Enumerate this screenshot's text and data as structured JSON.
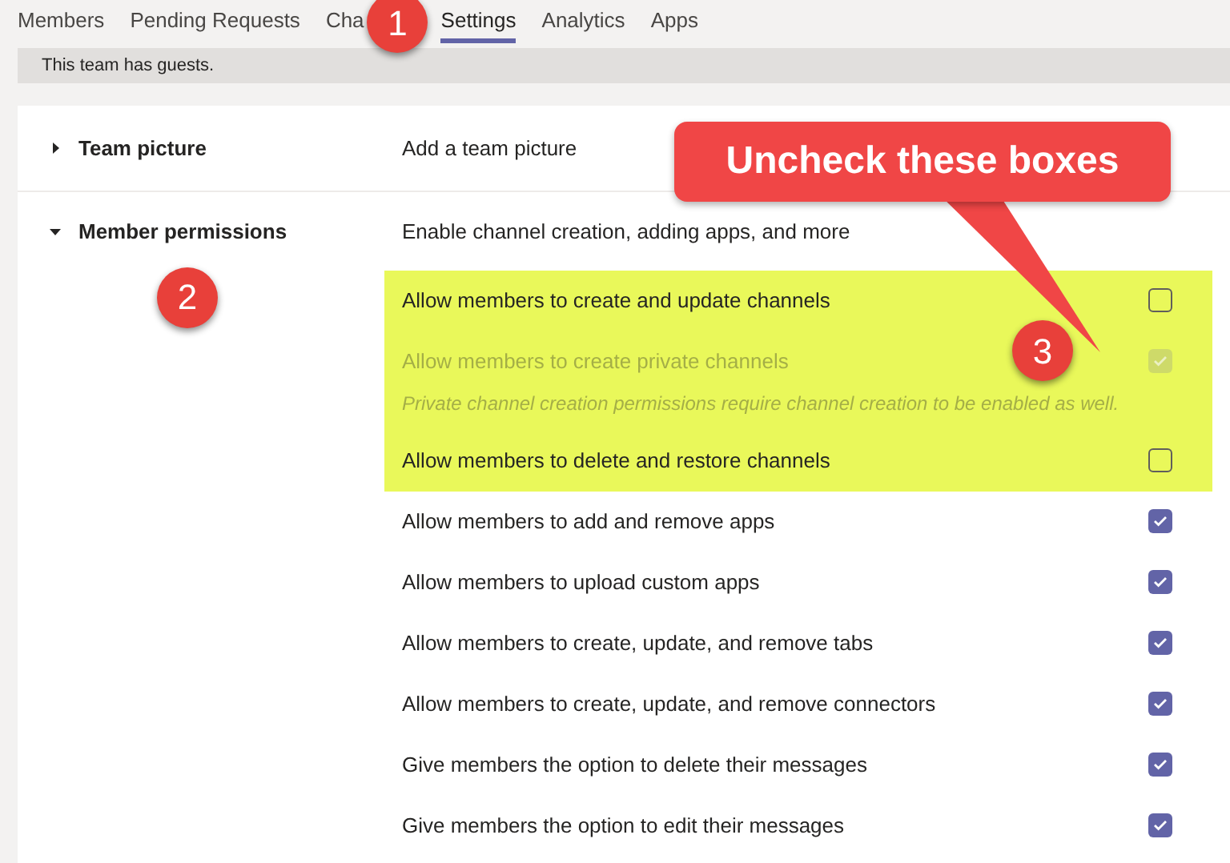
{
  "tabs": [
    {
      "label": "Members",
      "selected": false
    },
    {
      "label": "Pending Requests",
      "selected": false
    },
    {
      "label": "Cha",
      "selected": false
    },
    {
      "label": "Settings",
      "selected": true
    },
    {
      "label": "Analytics",
      "selected": false
    },
    {
      "label": "Apps",
      "selected": false
    }
  ],
  "banner": "This team has guests.",
  "sections": [
    {
      "title": "Team picture",
      "expanded": false,
      "description": "Add a team picture"
    },
    {
      "title": "Member permissions",
      "expanded": true,
      "description": "Enable channel creation, adding apps, and more",
      "settings": [
        {
          "kind": "toggle",
          "label": "Allow members to create and update channels",
          "checked": false,
          "disabled": false,
          "highlighted": true
        },
        {
          "kind": "toggle",
          "label": "Allow members to create private channels",
          "checked": true,
          "disabled": true,
          "highlighted": true
        },
        {
          "kind": "note",
          "label": "Private channel creation permissions require channel creation to be enabled as well.",
          "highlighted": true
        },
        {
          "kind": "toggle",
          "label": "Allow members to delete and restore channels",
          "checked": false,
          "disabled": false,
          "highlighted": true
        },
        {
          "kind": "toggle",
          "label": "Allow members to add and remove apps",
          "checked": true,
          "disabled": false,
          "highlighted": false
        },
        {
          "kind": "toggle",
          "label": "Allow members to upload custom apps",
          "checked": true,
          "disabled": false,
          "highlighted": false
        },
        {
          "kind": "toggle",
          "label": "Allow members to create, update, and remove tabs",
          "checked": true,
          "disabled": false,
          "highlighted": false
        },
        {
          "kind": "toggle",
          "label": "Allow members to create, update, and remove connectors",
          "checked": true,
          "disabled": false,
          "highlighted": false
        },
        {
          "kind": "toggle",
          "label": "Give members the option to delete their messages",
          "checked": true,
          "disabled": false,
          "highlighted": false
        },
        {
          "kind": "toggle",
          "label": "Give members the option to edit their messages",
          "checked": true,
          "disabled": false,
          "highlighted": false
        }
      ]
    }
  ],
  "annotations": {
    "callout": "Uncheck these boxes",
    "steps": [
      "1",
      "2",
      "3"
    ]
  }
}
